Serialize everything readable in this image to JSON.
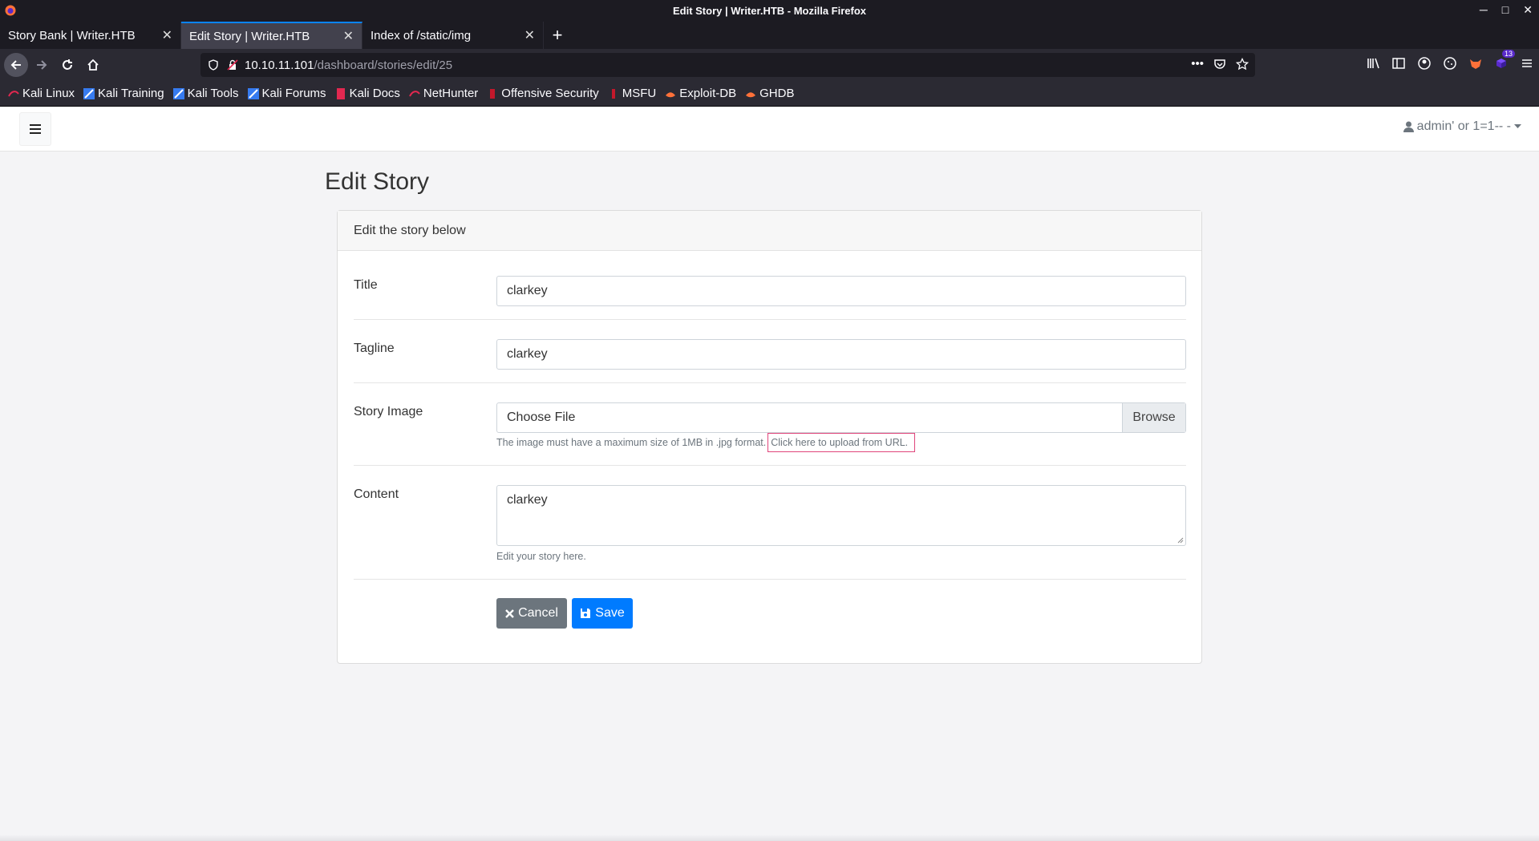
{
  "window": {
    "title": "Edit Story | Writer.HTB - Mozilla Firefox"
  },
  "tabs": [
    {
      "label": "Story Bank | Writer.HTB",
      "active": false
    },
    {
      "label": "Edit Story | Writer.HTB",
      "active": true
    },
    {
      "label": "Index of /static/img",
      "active": false
    }
  ],
  "urlbar": {
    "host": "10.10.11.101",
    "path": "/dashboard/stories/edit/25"
  },
  "toolbar": {
    "extension_badge": "13"
  },
  "bookmarks": [
    {
      "label": "Kali Linux",
      "icon": "kali-icon"
    },
    {
      "label": "Kali Training",
      "icon": "kali-training-icon"
    },
    {
      "label": "Kali Tools",
      "icon": "kali-tools-icon"
    },
    {
      "label": "Kali Forums",
      "icon": "kali-forums-icon"
    },
    {
      "label": "Kali Docs",
      "icon": "kali-docs-icon"
    },
    {
      "label": "NetHunter",
      "icon": "nethunter-icon"
    },
    {
      "label": "Offensive Security",
      "icon": "offsec-icon"
    },
    {
      "label": "MSFU",
      "icon": "msfu-icon"
    },
    {
      "label": "Exploit-DB",
      "icon": "exploitdb-icon"
    },
    {
      "label": "GHDB",
      "icon": "ghdb-icon"
    }
  ],
  "page": {
    "user_menu": "admin' or 1=1-- -",
    "heading": "Edit Story",
    "card_header": "Edit the story below",
    "title_label": "Title",
    "title_value": "clarkey",
    "tagline_label": "Tagline",
    "tagline_value": "clarkey",
    "image_label": "Story Image",
    "file_placeholder": "Choose File",
    "browse_label": "Browse",
    "image_help": "The image must have a maximum size of 1MB in .jpg format.",
    "url_upload_link": "Click here to upload from URL.",
    "content_label": "Content",
    "content_value": "clarkey",
    "content_help": "Edit your story here.",
    "cancel_label": "Cancel",
    "save_label": "Save"
  },
  "colors": {
    "primary": "#007bff",
    "secondary": "#6c757d",
    "highlight_box": "#e0457b",
    "browser_dark": "#1c1b22"
  }
}
